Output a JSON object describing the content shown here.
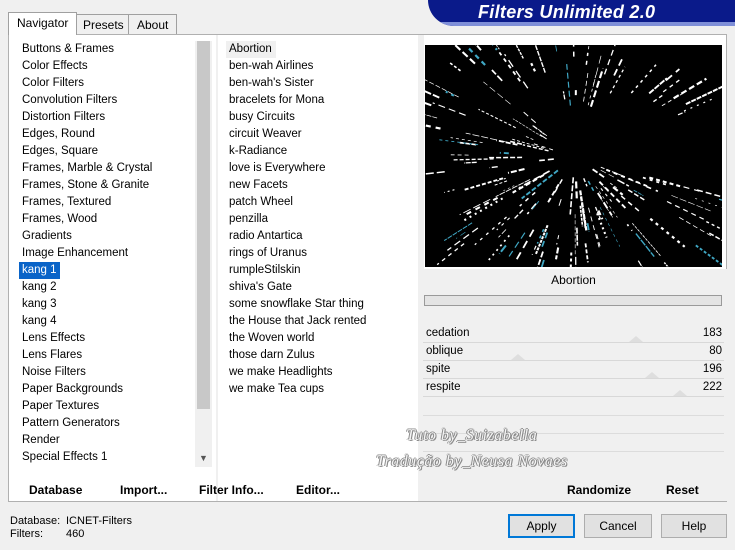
{
  "banner": {
    "title": "Filters Unlimited 2.0"
  },
  "tabs": [
    {
      "label": "Navigator",
      "active": true
    },
    {
      "label": "Presets",
      "active": false
    },
    {
      "label": "About",
      "active": false
    }
  ],
  "categories": {
    "items": [
      "Buttons & Frames",
      "Color Effects",
      "Color Filters",
      "Convolution Filters",
      "Distortion Filters",
      "Edges, Round",
      "Edges, Square",
      "Frames, Marble & Crystal",
      "Frames, Stone & Granite",
      "Frames, Textured",
      "Frames, Wood",
      "Gradients",
      "Image Enhancement",
      "kang 1",
      "kang 2",
      "kang 3",
      "kang 4",
      "Lens Effects",
      "Lens Flares",
      "Noise Filters",
      "Paper Backgrounds",
      "Paper Textures",
      "Pattern Generators",
      "Render",
      "Special Effects 1"
    ],
    "selected": "kang 1"
  },
  "filters": {
    "items": [
      "Abortion",
      "ben-wah Airlines",
      "ben-wah's Sister",
      "bracelets for Mona",
      "busy Circuits",
      "circuit Weaver",
      "k-Radiance",
      "love is Everywhere",
      "new Facets",
      "patch Wheel",
      "penzilla",
      "radio Antartica",
      "rings of Uranus",
      "rumpleStilskin",
      "shiva's Gate",
      "some snowflake Star thing",
      "the House that Jack rented",
      "the Woven world",
      "those darn Zulus",
      "we make Headlights",
      "we make Tea cups"
    ],
    "selected": "Abortion"
  },
  "preview": {
    "filter_name": "Abortion"
  },
  "parameters": [
    {
      "label": "cedation",
      "value": "183"
    },
    {
      "label": "oblique",
      "value": "80"
    },
    {
      "label": "spite",
      "value": "196"
    },
    {
      "label": "respite",
      "value": "222"
    }
  ],
  "watermarks": {
    "line1": "Tuto by_Suizabella",
    "line2": "Tradução by_Neusa Novaes"
  },
  "bottom_buttons": {
    "database": "Database",
    "import": "Import...",
    "filter_info": "Filter Info...",
    "editor": "Editor...",
    "randomize": "Randomize",
    "reset": "Reset"
  },
  "status": {
    "database_label": "Database:",
    "database_value": "ICNET-Filters",
    "filters_label": "Filters:",
    "filters_value": "460"
  },
  "dialog_buttons": {
    "apply": "Apply",
    "cancel": "Cancel",
    "help": "Help"
  },
  "colors": {
    "accent": "#0a64c8",
    "banner": "#0a1a8a",
    "preview_ray": "#ffffff",
    "preview_tint": "#3fa7c4"
  }
}
